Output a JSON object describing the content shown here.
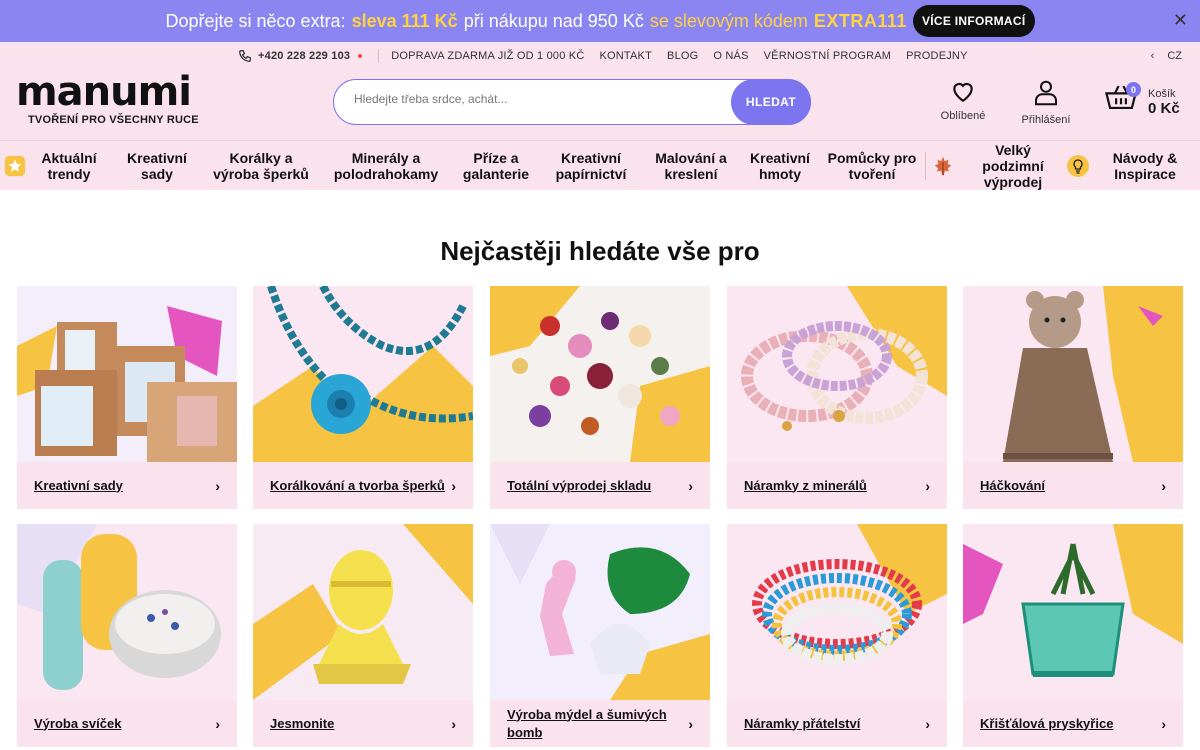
{
  "promo": {
    "text1": "Dopřejte si něco extra:",
    "highlight": "sleva 111 Kč",
    "text2": "při nákupu nad 950 Kč",
    "text3": "se slevovým kódem",
    "code": "EXTRA111",
    "more_label": "VÍCE INFORMACÍ",
    "close": "✕"
  },
  "topnav": {
    "phone": "+420 228 229 103",
    "links": [
      "DOPRAVA ZDARMA JIŽ OD 1 000 KČ",
      "KONTAKT",
      "BLOG",
      "O NÁS",
      "VĚRNOSTNÍ PROGRAM",
      "PRODEJNY"
    ],
    "lang": "CZ",
    "lang_chevron": "‹"
  },
  "logo": {
    "word": "manumi",
    "tagline": "TVOŘENÍ PRO VŠECHNY RUCE"
  },
  "search": {
    "placeholder": "Hledejte třeba srdce, achát...",
    "button": "HLEDAT"
  },
  "header_icons": {
    "favorites": "Oblíbené",
    "login": "Přihlášení",
    "cart_label": "Košík",
    "cart_amount": "0 Kč",
    "cart_count": "0"
  },
  "categories": [
    {
      "label": "Aktuální trendy",
      "icon": "star-badge-icon"
    },
    {
      "label": "Kreativní sady"
    },
    {
      "label": "Korálky a výroba šperků"
    },
    {
      "label": "Minerály a polodrahokamy"
    },
    {
      "label": "Příze a galanterie"
    },
    {
      "label": "Kreativní papírnictví"
    },
    {
      "label": "Malování a kreslení"
    },
    {
      "label": "Kreativní hmoty"
    },
    {
      "label": "Pomůcky pro tvoření"
    },
    {
      "label": "Velký podzimní výprodej",
      "icon": "autumn-leaf-icon"
    },
    {
      "label": "Návody & Inspirace",
      "icon": "lightbulb-icon"
    }
  ],
  "section_title": "Nejčastěji hledáte vše pro",
  "cards": [
    {
      "label": "Kreativní sady",
      "image": "creative-kits-image"
    },
    {
      "label": "Korálkování a tvorba šperků",
      "image": "beaded-necklace-image"
    },
    {
      "label": "Totální výprodej skladu",
      "image": "glass-beads-image"
    },
    {
      "label": "Náramky z minerálů",
      "image": "mineral-bracelets-image"
    },
    {
      "label": "Háčkování",
      "image": "crochet-bear-image"
    },
    {
      "label": "Výroba svíček",
      "image": "candles-image"
    },
    {
      "label": "Jesmonite",
      "image": "jesmonite-bust-image"
    },
    {
      "label": "Výroba mýdel a šumivých bomb",
      "image": "soap-shapes-image"
    },
    {
      "label": "Náramky přátelství",
      "image": "friendship-bracelets-image"
    },
    {
      "label": "Křišťálová pryskyřice",
      "image": "resin-planter-image"
    }
  ],
  "card_arrow": "›",
  "colors": {
    "accent": "#7d74f0",
    "promo_bg": "#8b85f2",
    "promo_highlight": "#ffd23f",
    "header_bg": "#fbe3ee"
  }
}
